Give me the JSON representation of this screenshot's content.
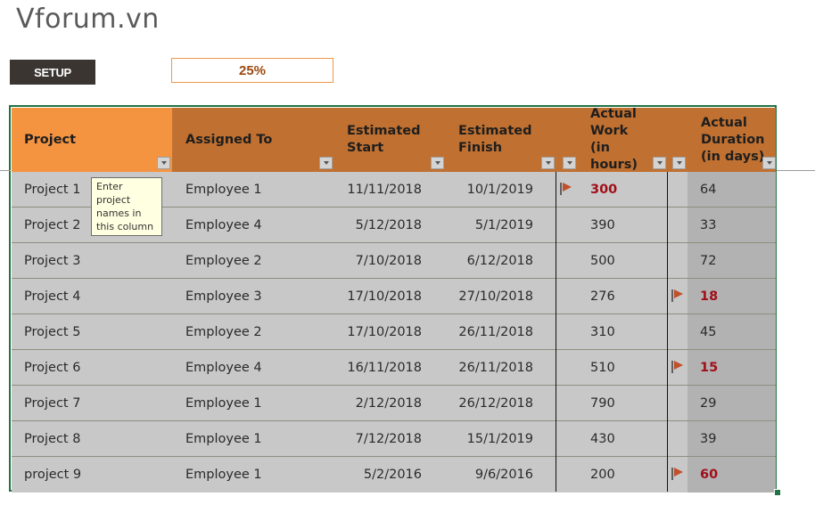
{
  "app": {
    "title": "Vforum.vn"
  },
  "toolbar": {
    "setup_label": "SETUP",
    "progress_value": "25%"
  },
  "table": {
    "columns": [
      {
        "key": "project",
        "label": "Project"
      },
      {
        "key": "assigned_to",
        "label": "Assigned To"
      },
      {
        "key": "estimated_start",
        "label": "Estimated Start"
      },
      {
        "key": "estimated_finish",
        "label": "Estimated Finish"
      },
      {
        "key": "flag_work",
        "label": ""
      },
      {
        "key": "actual_work",
        "label": "Actual Work (in hours)"
      },
      {
        "key": "flag_duration",
        "label": ""
      },
      {
        "key": "actual_duration",
        "label": "Actual Duration (in days)"
      }
    ],
    "rows": [
      {
        "project": "Project 1",
        "assigned_to": "Employee 1",
        "estimated_start": "11/11/2018",
        "estimated_finish": "10/1/2019",
        "flag_work": true,
        "actual_work": "300",
        "flag_duration": false,
        "actual_duration": "64"
      },
      {
        "project": "Project 2",
        "assigned_to": "Employee 4",
        "estimated_start": "5/12/2018",
        "estimated_finish": "5/1/2019",
        "flag_work": false,
        "actual_work": "390",
        "flag_duration": false,
        "actual_duration": "33"
      },
      {
        "project": "Project 3",
        "assigned_to": "Employee 2",
        "estimated_start": "7/10/2018",
        "estimated_finish": "6/12/2018",
        "flag_work": false,
        "actual_work": "500",
        "flag_duration": false,
        "actual_duration": "72"
      },
      {
        "project": "Project 4",
        "assigned_to": "Employee 3",
        "estimated_start": "17/10/2018",
        "estimated_finish": "27/10/2018",
        "flag_work": false,
        "actual_work": "276",
        "flag_duration": true,
        "actual_duration": "18"
      },
      {
        "project": "Project 5",
        "assigned_to": "Employee 2",
        "estimated_start": "17/10/2018",
        "estimated_finish": "26/11/2018",
        "flag_work": false,
        "actual_work": "310",
        "flag_duration": false,
        "actual_duration": "45"
      },
      {
        "project": "Project 6",
        "assigned_to": "Employee 4",
        "estimated_start": "16/11/2018",
        "estimated_finish": "26/11/2018",
        "flag_work": false,
        "actual_work": "510",
        "flag_duration": true,
        "actual_duration": "15"
      },
      {
        "project": "Project 7",
        "assigned_to": "Employee 1",
        "estimated_start": "2/12/2018",
        "estimated_finish": "26/12/2018",
        "flag_work": false,
        "actual_work": "790",
        "flag_duration": false,
        "actual_duration": "29"
      },
      {
        "project": "Project 8",
        "assigned_to": "Employee 1",
        "estimated_start": "7/12/2018",
        "estimated_finish": "15/1/2019",
        "flag_work": false,
        "actual_work": "430",
        "flag_duration": false,
        "actual_duration": "39"
      },
      {
        "project": "project 9",
        "assigned_to": "Employee 1",
        "estimated_start": "5/2/2016",
        "estimated_finish": "9/6/2016",
        "flag_work": false,
        "actual_work": "200",
        "flag_duration": true,
        "actual_duration": "60"
      }
    ]
  },
  "tooltip": {
    "text": "Enter project names in this column"
  },
  "colors": {
    "header_primary": "#f59440",
    "header_secondary": "#c07030",
    "flag": "#c0502a",
    "alert_text": "#a0101a",
    "selection_border": "#217346"
  }
}
